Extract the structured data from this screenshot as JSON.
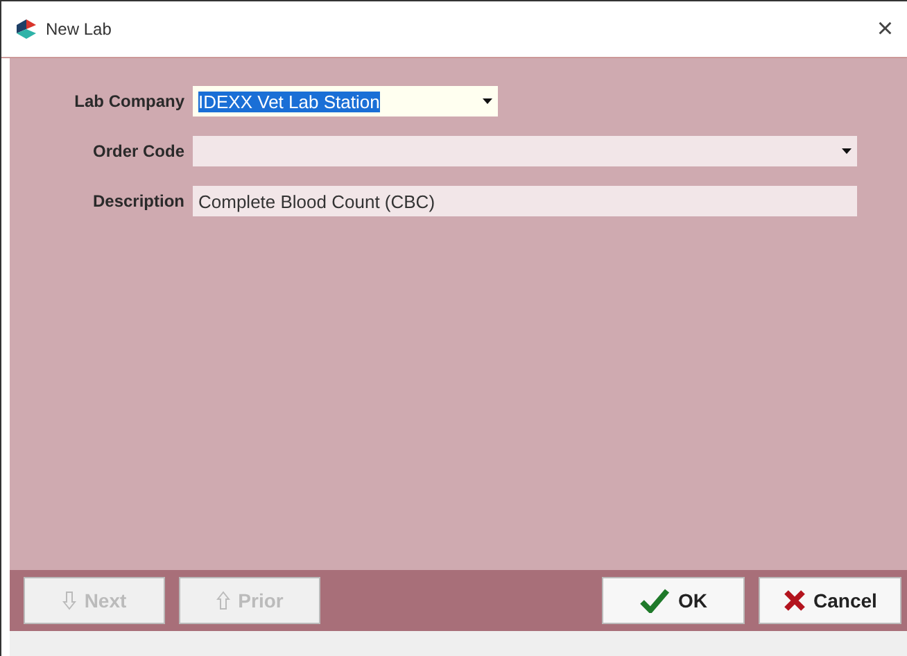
{
  "window": {
    "title": "New Lab",
    "close": "×"
  },
  "fields": [
    {
      "label": "Lab Company",
      "kind": "combo",
      "value": "IDEXX Vet Lab Station",
      "text_selected": true,
      "wide": false
    },
    {
      "label": "Order Code",
      "kind": "combo",
      "wide": true
    },
    {
      "label": "Description",
      "kind": "text",
      "value": "Complete Blood Count (CBC)",
      "text_selected": false,
      "wide": true
    }
  ],
  "nav_buttons": [
    {
      "label": "Next",
      "kind": "down",
      "disabled": true
    },
    {
      "label": "Prior",
      "kind": "up",
      "disabled": true
    }
  ],
  "action_buttons": [
    {
      "label": "OK",
      "kind": "check",
      "disabled": false
    },
    {
      "label": "Cancel",
      "kind": "cross",
      "disabled": false
    }
  ]
}
